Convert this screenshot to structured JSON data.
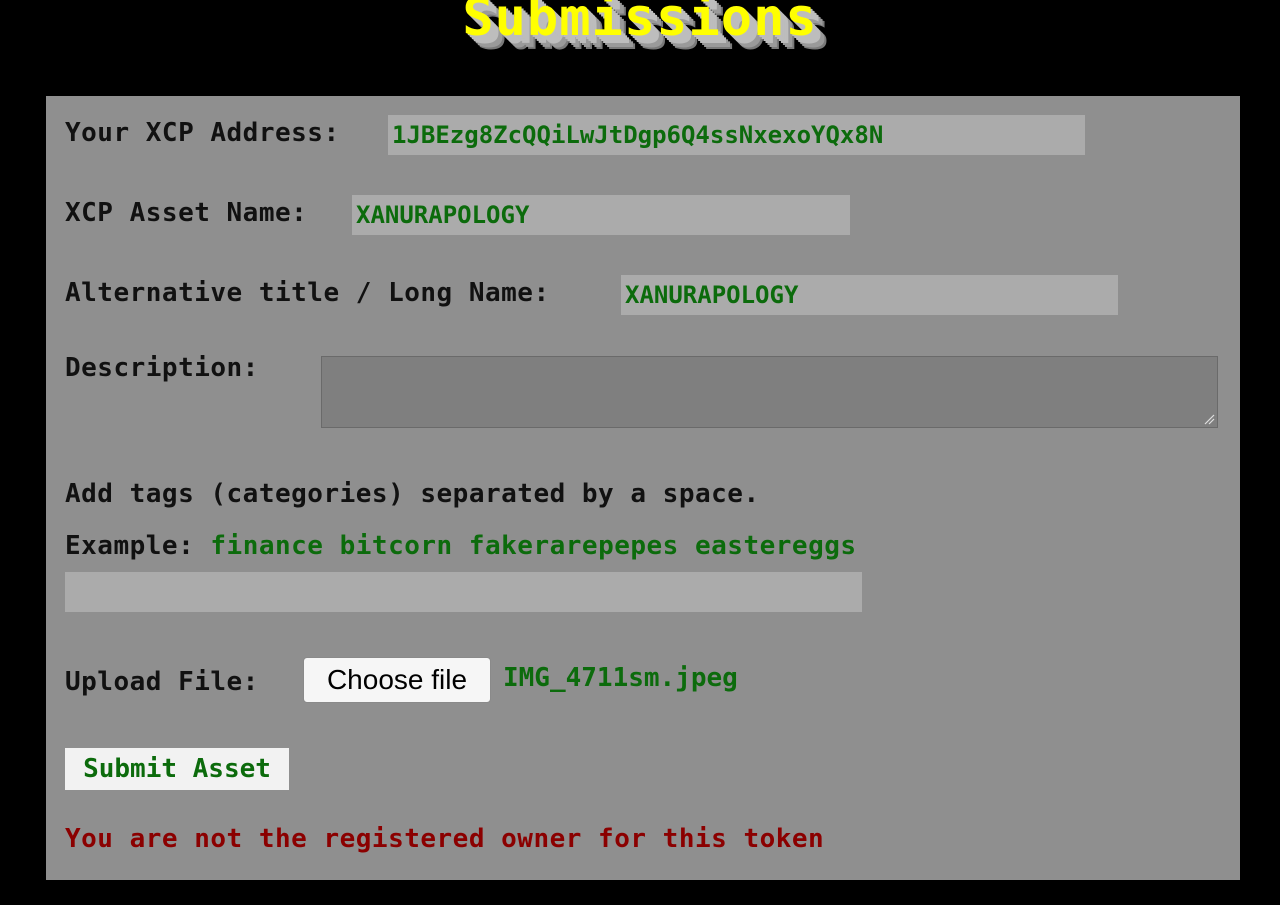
{
  "header": {
    "title": "Submissions"
  },
  "form": {
    "address_label": "Your XCP Address:",
    "address_value": "1JBEzg8ZcQQiLwJtDgp6Q4ssNxexoYQx8N",
    "asset_label": "XCP Asset Name:",
    "asset_value": "XANURAPOLOGY",
    "long_name_label": "Alternative title / Long Name:",
    "long_name_value": "XANURAPOLOGY",
    "description_label": "Description:",
    "description_value": "",
    "tags_instruction": "Add tags (categories) separated by a space.",
    "example_label": "Example:",
    "example_value": "finance bitcorn fakerarepepes eastereggs",
    "tags_value": "",
    "upload_label": "Upload File:",
    "choose_file_label": "Choose file",
    "file_name": "IMG_4711sm.jpeg",
    "submit_label": "Submit Asset",
    "error_message": "You are not the registered owner for this token"
  },
  "colors": {
    "background": "#000000",
    "panel": "#8f8f8f",
    "field": "#ababab",
    "value_text": "#0c6b0c",
    "error_text": "#8b0000",
    "title_text": "#ffff00"
  }
}
